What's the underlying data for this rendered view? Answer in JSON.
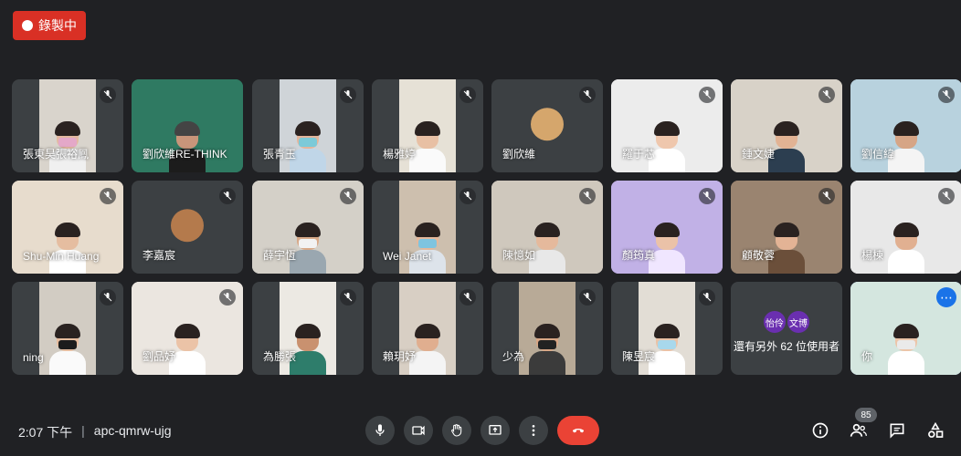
{
  "recording": {
    "label": "錄製中"
  },
  "tiles": [
    {
      "name": "張東昊張裕鳳"
    },
    {
      "name": "劉欣維RE-THINK"
    },
    {
      "name": "張青玉"
    },
    {
      "name": "楊雅婷"
    },
    {
      "name": "劉欣維"
    },
    {
      "name": "羅于芯"
    },
    {
      "name": "鍾文婕"
    },
    {
      "name": "劉信緯"
    },
    {
      "name": "Shu-Min Huang"
    },
    {
      "name": "李嘉宸"
    },
    {
      "name": "薛宇恆"
    },
    {
      "name": "Wei Janet"
    },
    {
      "name": "陳憶如"
    },
    {
      "name": "顏筠真"
    },
    {
      "name": "顧敬蓉"
    },
    {
      "name": "楊棟"
    },
    {
      "name": "ning"
    },
    {
      "name": "劉品妤"
    },
    {
      "name": "為勝張"
    },
    {
      "name": "賴玥妤"
    },
    {
      "name": "少為"
    },
    {
      "name": "陳昱宸"
    }
  ],
  "more_users": {
    "avatars": [
      "怡伶",
      "文博"
    ],
    "label": "還有另外 62 位使用者"
  },
  "self_tile": {
    "name": "你"
  },
  "footer": {
    "time": "2:07 下午",
    "separator": "|",
    "meeting_code": "apc-qmrw-ujg",
    "participant_count": "85"
  },
  "icons": {
    "mic": "mic-icon",
    "camera": "camera-icon",
    "hand": "raise-hand-icon",
    "present": "present-screen-icon",
    "more": "more-options-icon",
    "end": "end-call-icon",
    "info": "info-icon",
    "people": "people-icon",
    "chat": "chat-icon",
    "activities": "activities-icon"
  },
  "colors": {
    "background": "#202124",
    "tile": "#3c4043",
    "end_call": "#ea4335",
    "record": "#d93025",
    "self_border": "#8ab4f8"
  }
}
